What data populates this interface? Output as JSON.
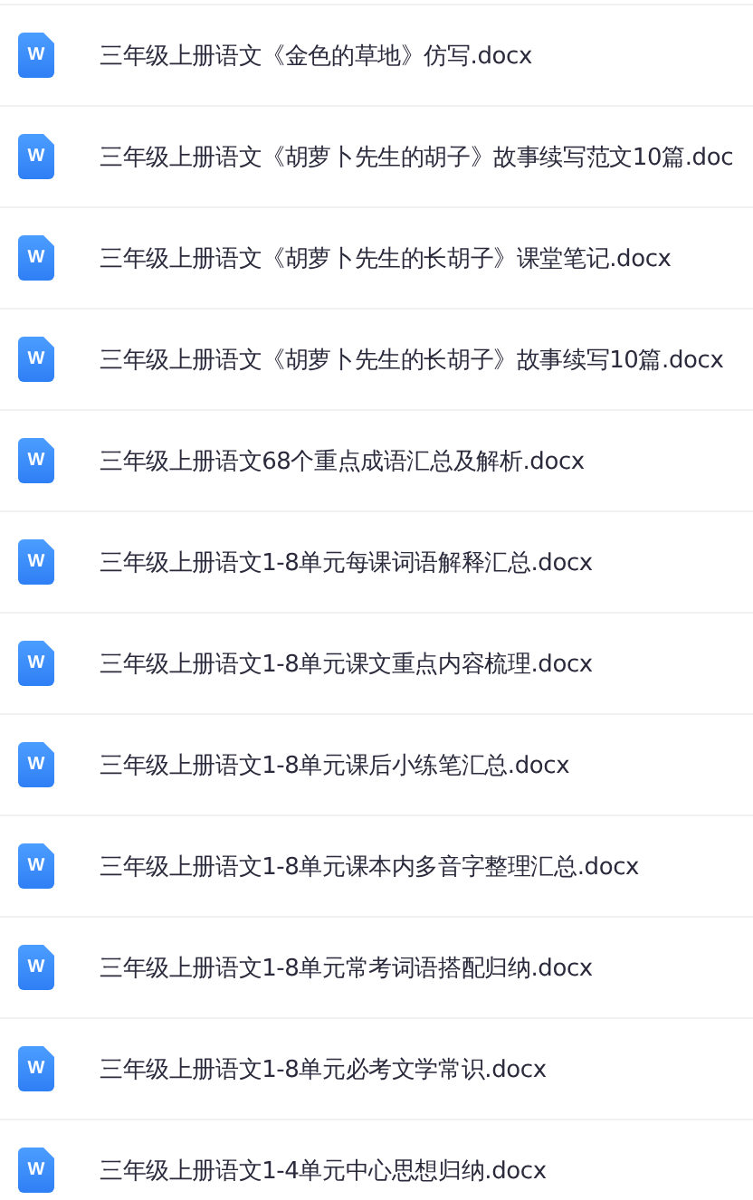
{
  "files": [
    {
      "icon_label": "W",
      "name": "三年级上册语文《金色的草地》仿写.docx"
    },
    {
      "icon_label": "W",
      "name": "三年级上册语文《胡萝卜先生的胡子》故事续写范文10篇.doc"
    },
    {
      "icon_label": "W",
      "name": "三年级上册语文《胡萝卜先生的长胡子》课堂笔记.docx"
    },
    {
      "icon_label": "W",
      "name": "三年级上册语文《胡萝卜先生的长胡子》故事续写10篇.docx"
    },
    {
      "icon_label": "W",
      "name": "三年级上册语文68个重点成语汇总及解析.docx"
    },
    {
      "icon_label": "W",
      "name": "三年级上册语文1-8单元每课词语解释汇总.docx"
    },
    {
      "icon_label": "W",
      "name": "三年级上册语文1-8单元课文重点内容梳理.docx"
    },
    {
      "icon_label": "W",
      "name": "三年级上册语文1-8单元课后小练笔汇总.docx"
    },
    {
      "icon_label": "W",
      "name": "三年级上册语文1-8单元课本内多音字整理汇总.docx"
    },
    {
      "icon_label": "W",
      "name": "三年级上册语文1-8单元常考词语搭配归纳.docx"
    },
    {
      "icon_label": "W",
      "name": "三年级上册语文1-8单元必考文学常识.docx"
    },
    {
      "icon_label": "W",
      "name": "三年级上册语文1-4单元中心思想归纳.docx"
    }
  ]
}
